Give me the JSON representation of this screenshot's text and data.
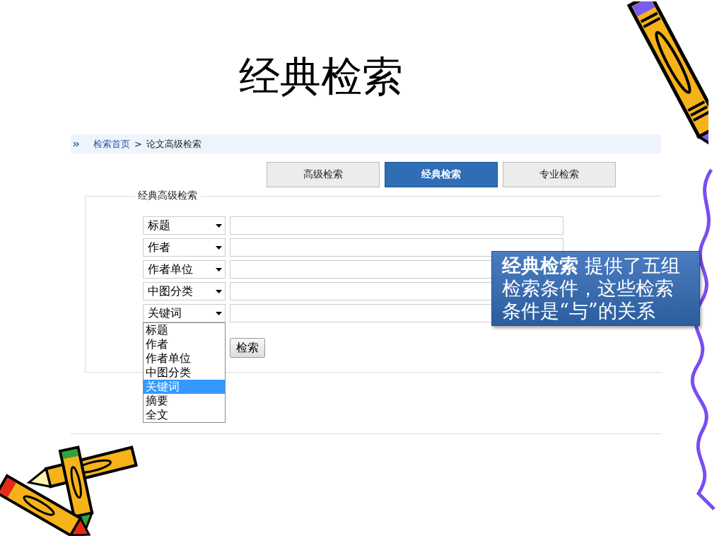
{
  "slide": {
    "title": "经典检索"
  },
  "breadcrumb": [
    {
      "label": "检索首页",
      "kind": "link"
    },
    {
      "label": ">",
      "kind": "separator"
    },
    {
      "label": "论文高级检索",
      "kind": "current"
    }
  ],
  "tabs": [
    {
      "label": "高级检索",
      "selected": false
    },
    {
      "label": "经典检索",
      "selected": true
    },
    {
      "label": "专业检索",
      "selected": false
    }
  ],
  "form": {
    "legend": "经典高级检索",
    "rows": [
      {
        "field": "标题"
      },
      {
        "field": "作者"
      },
      {
        "field": "作者单位"
      },
      {
        "field": "中图分类"
      },
      {
        "field": "关键词"
      }
    ],
    "submit": "检索"
  },
  "dropdown": {
    "options": [
      {
        "label": "标题",
        "selected": false
      },
      {
        "label": "作者",
        "selected": false
      },
      {
        "label": "作者单位",
        "selected": false
      },
      {
        "label": "中图分类",
        "selected": false
      },
      {
        "label": "关键词",
        "selected": true
      },
      {
        "label": "摘要",
        "selected": false
      },
      {
        "label": "全文",
        "selected": false
      }
    ]
  },
  "callout": {
    "text": "**经典检索** 提供了五组检索条件，这些检索条件是“与”的关系"
  }
}
